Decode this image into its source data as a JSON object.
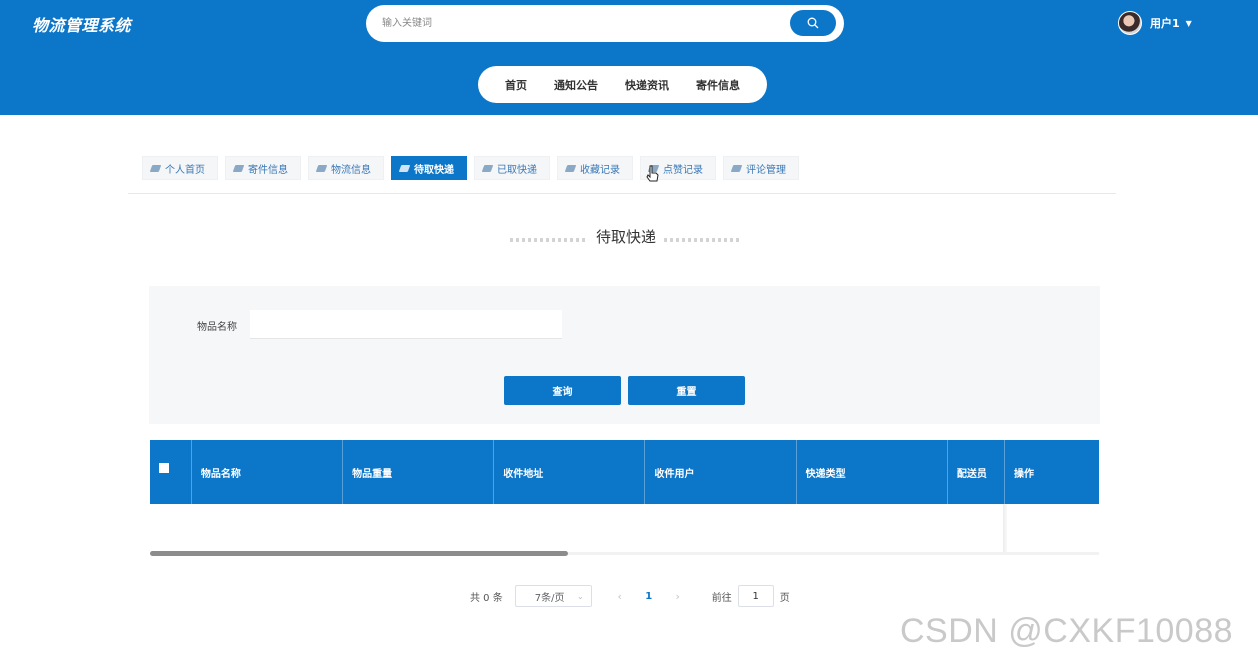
{
  "header": {
    "logo": "物流管理系统",
    "search_placeholder": "输入关键词",
    "user_name": "用户1",
    "nav": [
      "首页",
      "通知公告",
      "快递资讯",
      "寄件信息"
    ]
  },
  "tabs": [
    "个人首页",
    "寄件信息",
    "物流信息",
    "待取快递",
    "已取快递",
    "收藏记录",
    "点赞记录",
    "评论管理"
  ],
  "active_tab": "待取快递",
  "page_title": "待取快递",
  "form": {
    "field_label": "物品名称",
    "field_value": "",
    "query_button": "查询",
    "reset_button": "重置"
  },
  "table": {
    "columns": [
      "物品名称",
      "物品重量",
      "收件地址",
      "收件用户",
      "快递类型",
      "配送员"
    ],
    "ops_column": "操作",
    "rows": []
  },
  "pagination": {
    "total": "共 0 条",
    "page_size": "7条/页",
    "current_page": "1",
    "goto_label": "前往",
    "goto_value": "1",
    "page_suffix": "页"
  },
  "watermark": "CSDN @CXKF10088",
  "colors": {
    "primary": "#0c76c9"
  }
}
